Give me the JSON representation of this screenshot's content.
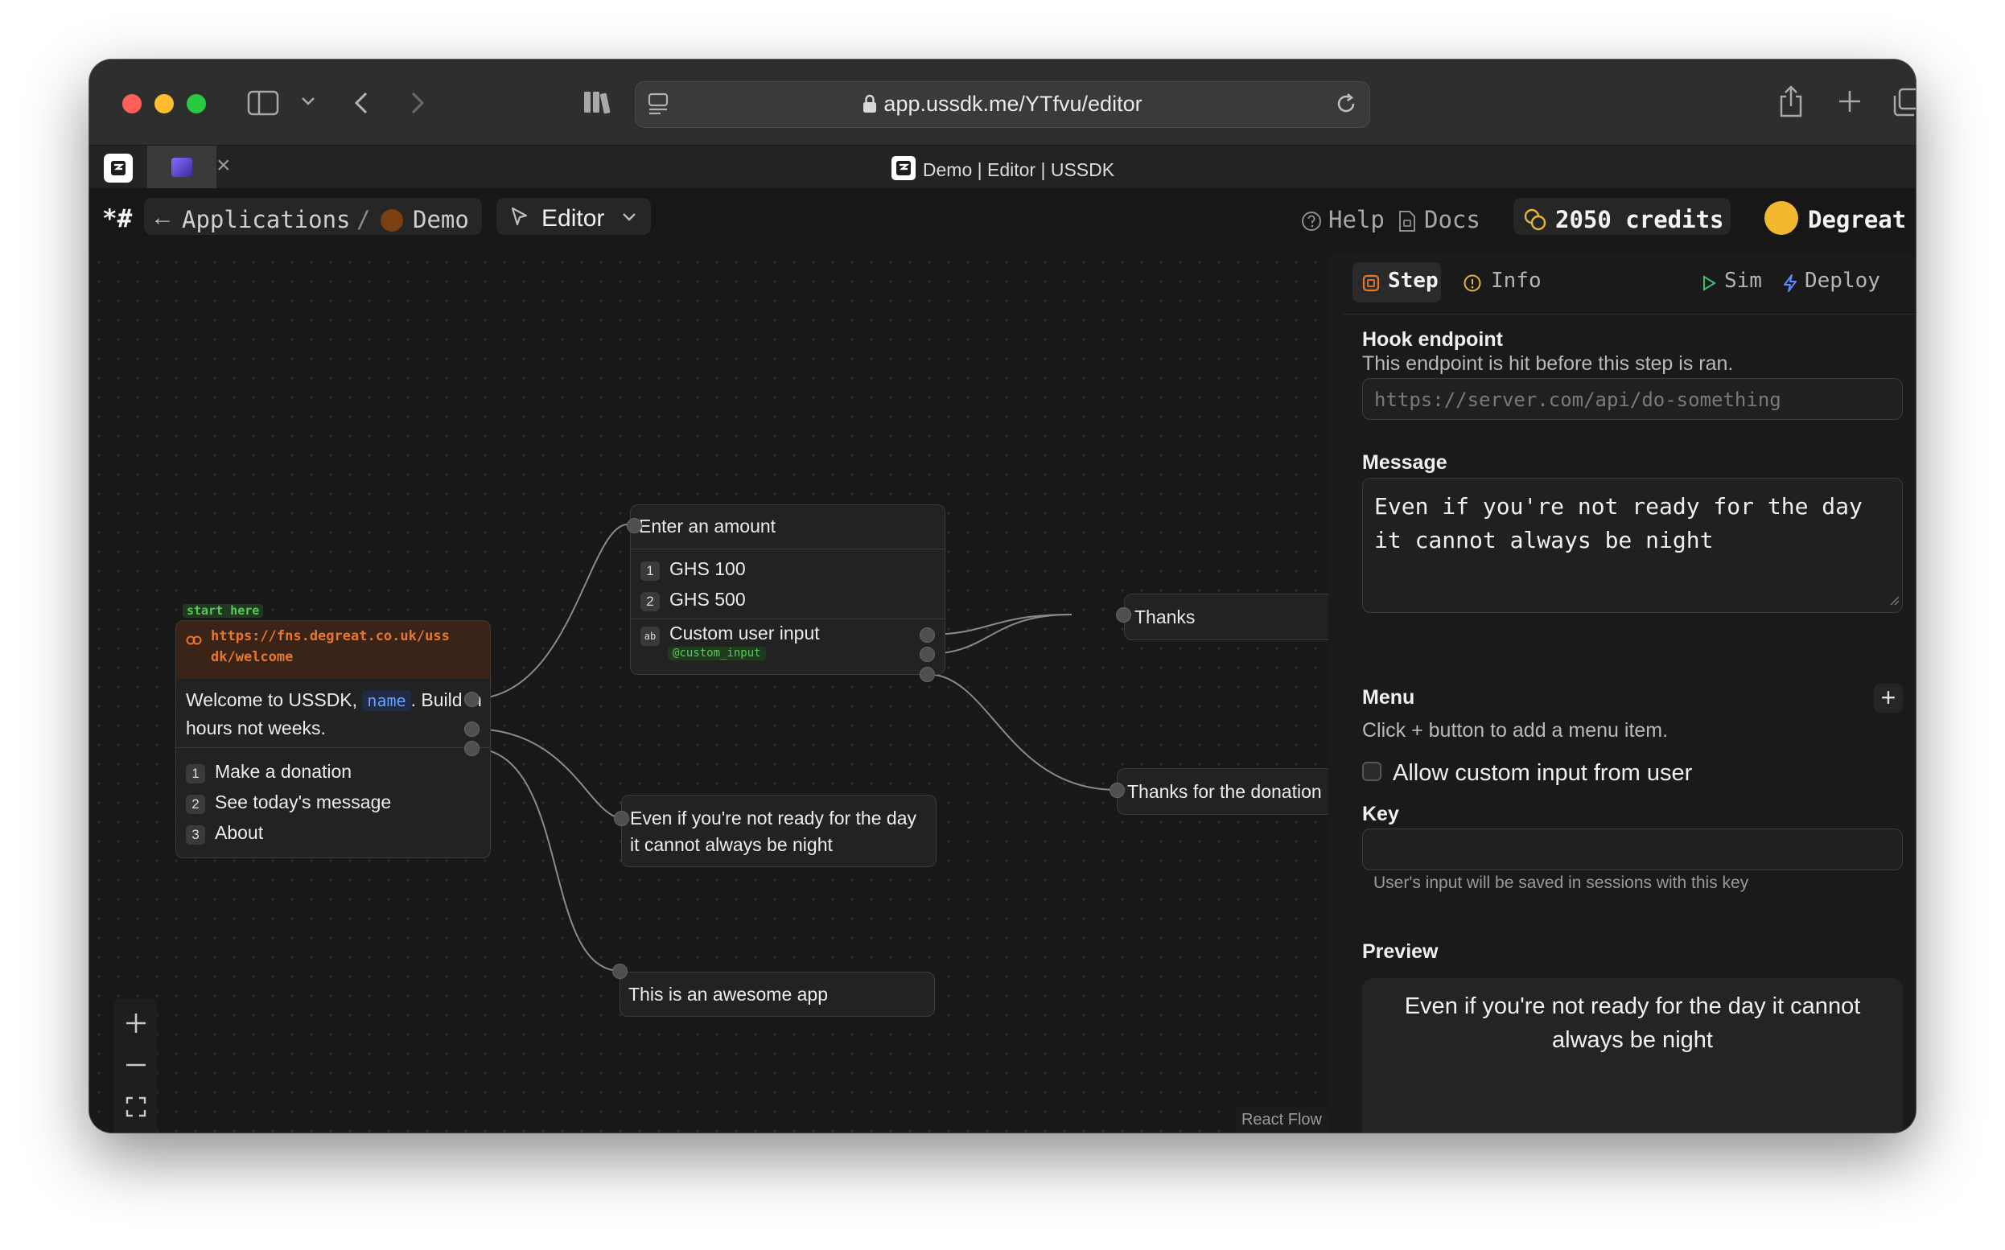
{
  "browser": {
    "url": "app.ussdk.me/YTfvu/editor",
    "tab_title": "Demo | Editor | USSDK",
    "tab_close": "×"
  },
  "header": {
    "logo": "*#",
    "back_arrow": "←",
    "breadcrumb_applications": "Applications",
    "breadcrumb_sep": "/",
    "app_name": "Demo",
    "mode": "Editor",
    "help": "Help",
    "docs": "Docs",
    "credits": "2050 credits",
    "user": "Degreat"
  },
  "canvas": {
    "start_node": {
      "badge": "start here",
      "url": "https://fns.degreat.co.uk/ussdk/welcome",
      "url_line1": "https://fns.degreat.co.uk/uss",
      "url_line2": "dk/welcome",
      "message_before": "Welcome to USSDK,",
      "variable": "name",
      "message_after": ". Build in",
      "message_line2": "hours not weeks.",
      "options": [
        {
          "num": "1",
          "label": "Make a donation"
        },
        {
          "num": "2",
          "label": "See today's message"
        },
        {
          "num": "3",
          "label": "About"
        }
      ]
    },
    "amount_node": {
      "title": "Enter an amount",
      "options": [
        {
          "num": "1",
          "label": "GHS 100"
        },
        {
          "num": "2",
          "label": "GHS 500"
        }
      ],
      "custom_icon": "ab",
      "custom_label": "Custom user input",
      "custom_key": "@custom_input"
    },
    "thanks_node": {
      "title": "Thanks"
    },
    "donation_node": {
      "title": "Thanks for the donation"
    },
    "message_node": {
      "line1": "Even if you're not ready for the day",
      "line2": "it cannot always be night"
    },
    "about_node": {
      "title": "This is an awesome app"
    },
    "attribution": "React Flow"
  },
  "panel": {
    "tabs": {
      "step": "Step",
      "info": "Info",
      "sim": "Sim",
      "deploy": "Deploy"
    },
    "hook": {
      "label": "Hook endpoint",
      "description": "This endpoint is hit before this step is ran.",
      "placeholder": "https://server.com/api/do-something"
    },
    "message": {
      "label": "Message",
      "line1": "Even if you're not ready for the day",
      "line2": "it cannot always be night"
    },
    "menu": {
      "label": "Menu",
      "hint": "Click + button to add a menu item.",
      "add": "+"
    },
    "custom_input_label": "Allow custom input from user",
    "key": {
      "label": "Key",
      "help": "User's input will be saved in sessions with this key"
    },
    "preview": {
      "label": "Preview",
      "line1": "Even if you're not ready for the day it cannot",
      "line2": "always be night"
    }
  },
  "colors": {
    "accent_orange": "#e8772e",
    "green_badge": "#4caf50",
    "variable_blue": "#6ea0ff",
    "credits_gold": "#e5b53a",
    "avatar": "#f2b930"
  }
}
